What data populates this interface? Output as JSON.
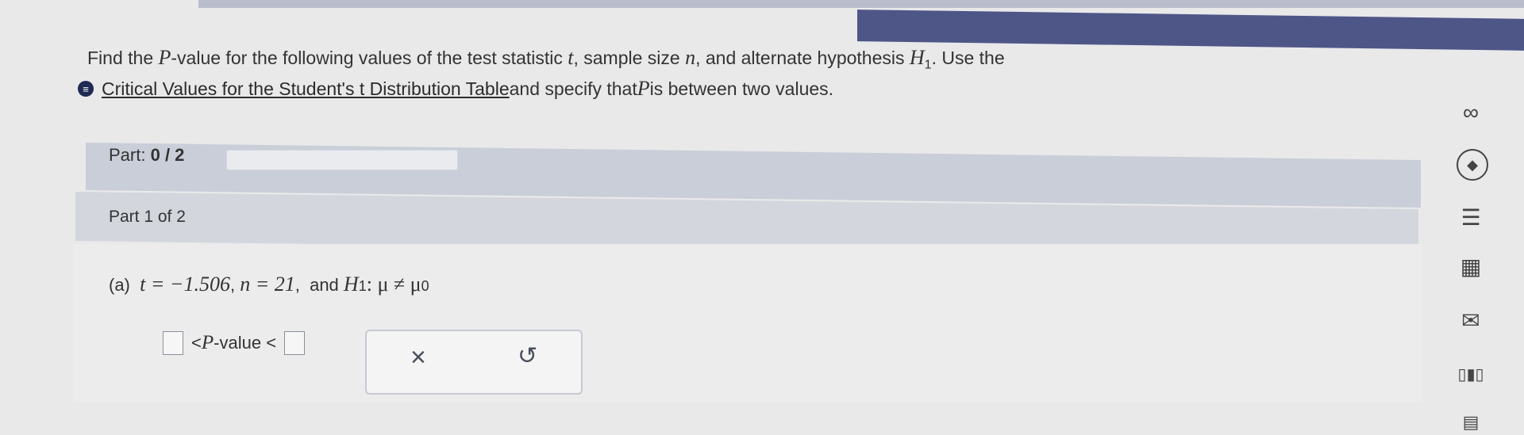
{
  "question": {
    "prefix": "Find the ",
    "p": "P",
    "middle": "-value for the following values of the test statistic ",
    "t": "t",
    "sample_text": ", sample size ",
    "n": "n",
    "alt_text": ", and alternate hypothesis ",
    "h": "H",
    "h_sub": "1",
    "suffix": ". Use the",
    "info_glyph": "≡",
    "link_text": "Critical Values for the Student's t Distribution Table",
    "line2_rest": " and specify that ",
    "p2": "P",
    "line2_end": " is between two values."
  },
  "part": {
    "label": "Part:",
    "progress": "0 / 2"
  },
  "part_of": {
    "label": "Part 1 of 2"
  },
  "problem": {
    "part_letter": "(a)",
    "t_expr": "t = −1.506",
    "n_expr": "n = 21",
    "and_text": "and",
    "h": "H",
    "h_sub": "1",
    "h_rest": " : μ ≠ μ",
    "mu_sub": "0"
  },
  "answer": {
    "lt1": "<",
    "p": "P",
    "value_text": "-value",
    "lt2": "<"
  },
  "tools": {
    "close": "×",
    "undo": "↺"
  },
  "sidebar": {
    "icons": [
      {
        "name": "infinity-icon",
        "glyph": "∞"
      },
      {
        "name": "hint-icon",
        "glyph": "◆"
      },
      {
        "name": "ebook-icon",
        "glyph": "☰"
      },
      {
        "name": "calculator-icon",
        "glyph": "▦"
      },
      {
        "name": "mail-icon",
        "glyph": "✉"
      },
      {
        "name": "chart-icon",
        "glyph": "▯▮▯"
      },
      {
        "name": "doc-icon",
        "glyph": "▤"
      }
    ]
  }
}
